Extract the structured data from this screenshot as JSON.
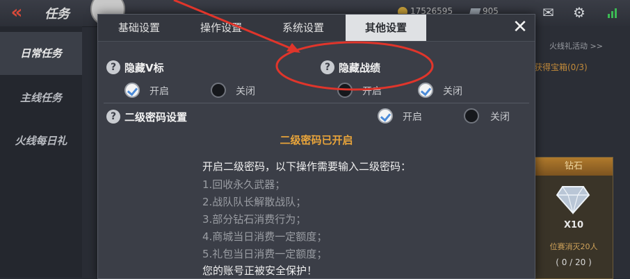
{
  "topbar": {
    "title": "任务",
    "gold": "17526595",
    "diamonds": "905"
  },
  "left_nav": [
    "日常任务",
    "主线任务",
    "火线每日礼"
  ],
  "right_panel": {
    "link": "火线礼活动 >>",
    "progress": "获得宝箱(0/3)",
    "reward": {
      "header": "钻石",
      "qty": "X10",
      "desc": "位赛消灭20人",
      "count": "( 0 / 20 )"
    }
  },
  "dialog": {
    "tabs": [
      "基础设置",
      "操作设置",
      "系统设置",
      "其他设置"
    ],
    "active_tab": 3,
    "close": "✕",
    "options": {
      "hide_v": {
        "label": "隐藏V标",
        "on": "开启",
        "off": "关闭",
        "selected": "on"
      },
      "hide_record": {
        "label": "隐藏战绩",
        "on": "开启",
        "off": "关闭",
        "selected": "off"
      },
      "second_pwd": {
        "label": "二级密码设置",
        "on": "开启",
        "off": "关闭",
        "selected": "on"
      }
    },
    "status": "二级密码已开启",
    "info": {
      "head": "开启二级密码，以下操作需要输入二级密码：",
      "items": [
        "1.回收永久武器；",
        "2.战队队长解散战队；",
        "3.部分钻石消费行为；",
        "4.商城当日消费一定额度；",
        "5.礼包当日消费一定额度；"
      ],
      "foot": "您的账号正被安全保护！"
    }
  },
  "colors": {
    "annotation": "#e0352b",
    "accent_orange": "#e8a43a",
    "check_blue": "#4c8bd8"
  }
}
